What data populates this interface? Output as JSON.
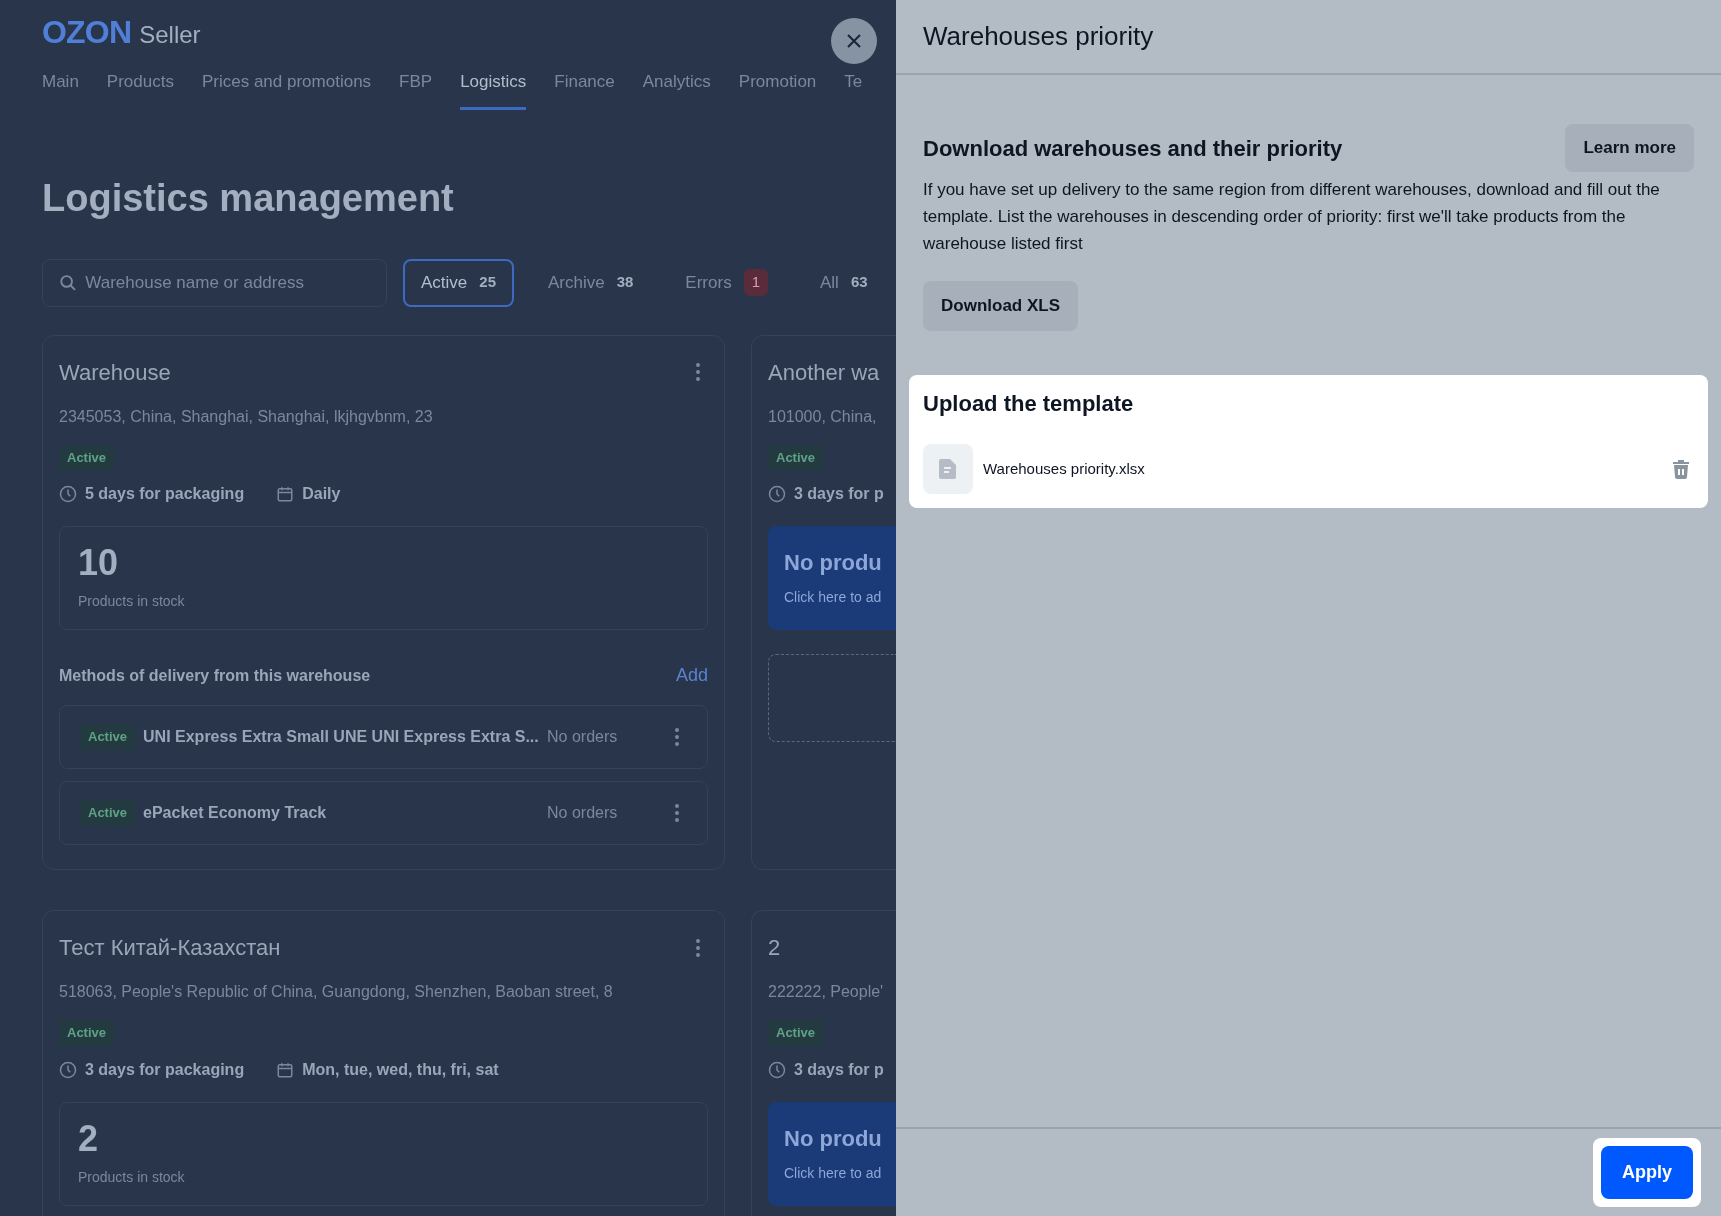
{
  "brand": {
    "logo": "OZON",
    "product": "Seller"
  },
  "nav": [
    {
      "label": "Main",
      "selected": false
    },
    {
      "label": "Products",
      "selected": false
    },
    {
      "label": "Prices and promotions",
      "selected": false
    },
    {
      "label": "FBP",
      "selected": false
    },
    {
      "label": "Logistics",
      "selected": true
    },
    {
      "label": "Finance",
      "selected": false
    },
    {
      "label": "Analytics",
      "selected": false
    },
    {
      "label": "Promotion",
      "selected": false
    },
    {
      "label": "Te",
      "selected": false
    }
  ],
  "page_title": "Logistics management",
  "search": {
    "placeholder": "Warehouse name or address"
  },
  "filters": [
    {
      "label": "Active",
      "count": "25",
      "selected": true,
      "kind": "plain"
    },
    {
      "label": "Archive",
      "count": "38",
      "selected": false,
      "kind": "plain"
    },
    {
      "label": "Errors",
      "count": "1",
      "selected": false,
      "kind": "alert"
    },
    {
      "label": "All",
      "count": "63",
      "selected": false,
      "kind": "plain"
    }
  ],
  "warehouses": [
    {
      "name": "Warehouse",
      "menu": true,
      "address": "2345053, China, Shanghai, Shanghai, lkjhgvbnm, 23",
      "status": "Active",
      "packaging": "5 days for packaging",
      "schedule": "Daily",
      "stock": {
        "kind": "count",
        "value": "10",
        "label": "Products in stock"
      },
      "methods_title": "Methods of delivery from this warehouse",
      "add": "Add",
      "methods": [
        {
          "status": "Active",
          "name": "UNI Express Extra Small UNE UNI Express Extra S...",
          "orders": "No orders"
        },
        {
          "status": "Active",
          "name": "ePacket Economy Track",
          "orders": "No orders"
        }
      ]
    },
    {
      "name": "Another wa",
      "menu": false,
      "address": "101000, China, ",
      "status": "Active",
      "packaging": "3 days for p",
      "stock": {
        "kind": "empty",
        "value": "No produ",
        "label": "Click here to ad"
      },
      "add_slot": true
    },
    {
      "name": "Тест Китай-Казахстан",
      "menu": true,
      "address": "518063, People's Republic of China, Guangdong, Shenzhen, Baoban street, 8",
      "status": "Active",
      "packaging": "3 days for packaging",
      "schedule": "Mon, tue, wed, thu, fri, sat",
      "stock": {
        "kind": "count",
        "value": "2",
        "label": "Products in stock"
      }
    },
    {
      "name": "2",
      "menu": false,
      "address": "222222, People'",
      "status": "Active",
      "packaging": "3 days for p",
      "stock": {
        "kind": "empty",
        "value": "No produ",
        "label": "Click here to ad"
      }
    }
  ],
  "panel": {
    "title": "Warehouses priority",
    "download": {
      "title": "Download warehouses and their priority",
      "learn_more": "Learn more",
      "text": "If you have set up delivery to the same region from different warehouses, download and fill out the template. List the warehouses in descending order of priority: first we'll take products from the warehouse listed first",
      "button": "Download XLS"
    },
    "upload": {
      "title": "Upload the template",
      "file": "Warehouses priority.xlsx"
    },
    "apply": "Apply"
  }
}
